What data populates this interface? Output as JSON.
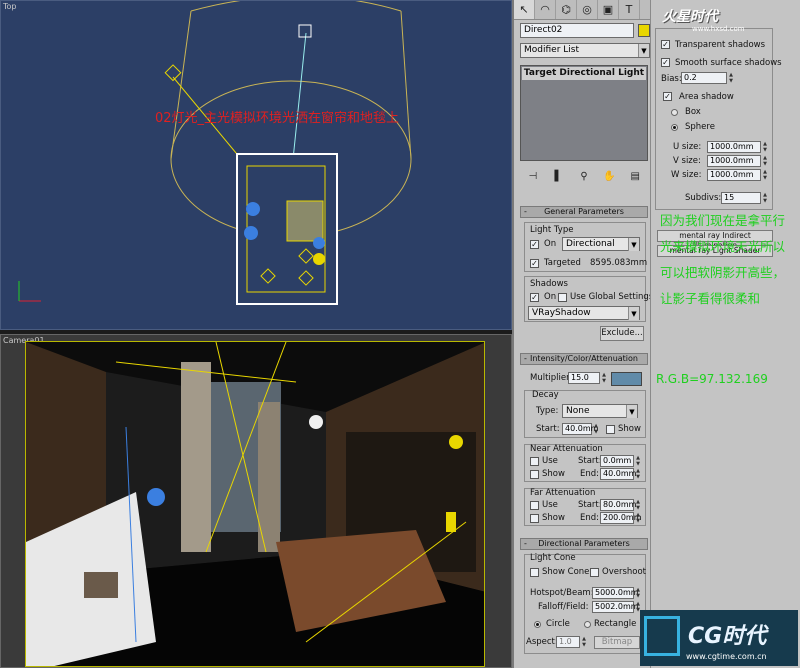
{
  "viewports": {
    "top": {
      "label": "Top",
      "annotation": "02灯光_主光模拟环境光洒在窗帘和地毯上"
    },
    "camera": {
      "label": "Camera01"
    }
  },
  "command_panel": {
    "tabs": [
      {
        "icon": "pointer-icon",
        "glyph": "↖"
      },
      {
        "icon": "curve-icon",
        "glyph": "◠"
      },
      {
        "icon": "hierarchy-icon",
        "glyph": "⌬"
      },
      {
        "icon": "motion-icon",
        "glyph": "◎"
      },
      {
        "icon": "display-icon",
        "glyph": "▣"
      },
      {
        "icon": "utilities-icon",
        "glyph": "T"
      }
    ],
    "object_name": "Direct02",
    "object_color": "#e8d600",
    "modifier_list": "Modifier List",
    "stack_item": "Target Directional Light",
    "general": {
      "title": "General Parameters",
      "light_type_label": "Light Type",
      "on_label": "On",
      "light_type": "Directional",
      "targeted_label": "Targeted",
      "target_distance": "8595.083mm",
      "shadows_label": "Shadows",
      "shadows_on_label": "On",
      "use_global_label": "Use Global Settings",
      "shadow_type": "VRayShadow",
      "exclude_label": "Exclude..."
    },
    "intensity": {
      "title": "Intensity/Color/Attenuation",
      "multiplier_label": "Multiplier:",
      "multiplier": "15.0",
      "color": "#618ba9",
      "decay_label": "Decay",
      "type_label": "Type:",
      "type_value": "None",
      "start_label": "Start:",
      "start_value": "40.0mm",
      "show_label": "Show",
      "near_label": "Near Attenuation",
      "use_label": "Use",
      "near_start_label": "Start:",
      "near_start": "0.0mm",
      "near_show_label": "Show",
      "near_end_label": "End:",
      "near_end": "40.0mm",
      "far_label": "Far Attenuation",
      "far_use_label": "Use",
      "far_start_label": "Start:",
      "far_start": "80.0mm",
      "far_show_label": "Show",
      "far_end_label": "End:",
      "far_end": "200.0mm"
    },
    "directional": {
      "title": "Directional Parameters",
      "light_cone_label": "Light Cone",
      "show_cone_label": "Show Cone",
      "overshoot_label": "Overshoot",
      "hotspot_label": "Hotspot/Beam:",
      "hotspot": "5000.0mm",
      "falloff_label": "Falloff/Field:",
      "falloff": "5002.0mm",
      "circle_label": "Circle",
      "rectangle_label": "Rectangle",
      "aspect_label": "Aspect:",
      "aspect": "1.0",
      "bitmap_label": "Bitmap"
    }
  },
  "vray_panel": {
    "logo": "火星时代",
    "logo_url": "www.hxsd.com",
    "transparent_shadows_label": "Transparent shadows",
    "smooth_shadows_label": "Smooth surface shadows",
    "bias_label": "Bias:",
    "bias": "0.2",
    "area_shadow_label": "Area shadow",
    "box_label": "Box",
    "sphere_label": "Sphere",
    "u_label": "U size:",
    "u_size": "1000.0mm",
    "v_label": "V size:",
    "v_size": "1000.0mm",
    "w_label": "W size:",
    "w_size": "1000.0mm",
    "subdivs_label": "Subdivs:",
    "subdivs": "15",
    "mental_ray_1": "mental ray Indirect Illumination",
    "mental_ray_2": "mental ray Light Shader"
  },
  "notes": {
    "explanation": "因为我们现在是拿平行光来模拟环境天光所以可以把软阴影开高些，让影子看得很柔和",
    "rgb": "R.G.B=97.132.169"
  },
  "watermark": {
    "brand": "CG时代",
    "url": "www.cgtime.com.cn"
  }
}
